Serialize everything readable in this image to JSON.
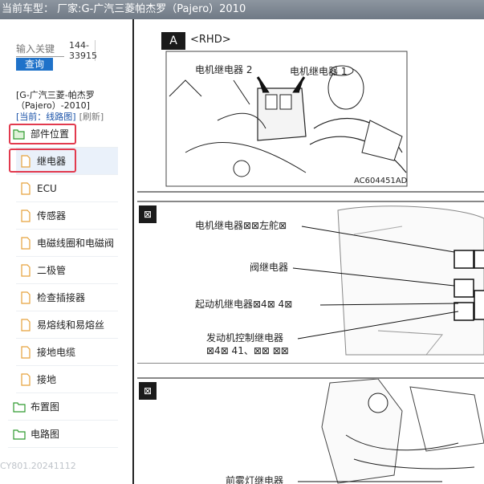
{
  "title": {
    "prefix": "当前车型：",
    "model": "厂家:G-广汽三菱帕杰罗（Pajero）2010"
  },
  "search": {
    "placeholder": "输入关键",
    "button": "查询",
    "code": "144-33915"
  },
  "vehicle_label": "[G-广汽三菱-帕杰罗（Pajero）-2010]",
  "current": {
    "label": "[当前：线路图]",
    "refresh": "[刷新]"
  },
  "tree": {
    "folder_parts": "部件位置",
    "items": [
      "继电器",
      "ECU",
      "传感器",
      "电磁线圈和电磁阀",
      "二极管",
      "检查插接器",
      "易熔线和易熔丝",
      "接地电缆",
      "接地"
    ],
    "folder_layout": "布置图",
    "folder_circuit": "电路图"
  },
  "footer": "CY801.20241112",
  "diagram1": {
    "section": "A",
    "variant": "<RHD>",
    "label_relay2": "电机继电器 2",
    "label_relay1": "电机继电器 1",
    "ref": "AC604451AD"
  },
  "diagram2": {
    "icon": "⊠",
    "labels": [
      "电机继电器⊠⊠左舵⊠",
      "阀继电器",
      "起动机继电器⊠4⊠ 4⊠",
      "发动机控制继电器",
      "⊠4⊠ 41、⊠⊠ ⊠⊠"
    ]
  },
  "diagram3": {
    "icon": "⊠",
    "label": "前雾灯继电器"
  },
  "colors": {
    "accent": "#1f72c9",
    "highlight": "#e23a4e",
    "titlebar": "#7a838e"
  }
}
